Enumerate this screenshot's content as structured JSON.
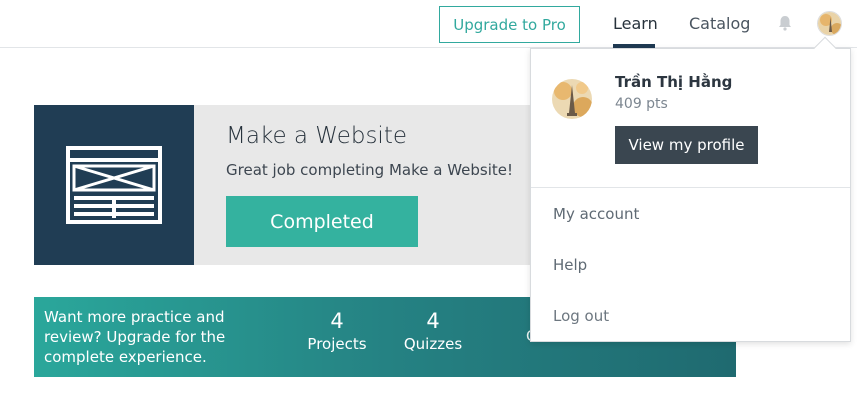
{
  "nav": {
    "upgrade_label": "Upgrade to Pro",
    "learn_label": "Learn",
    "catalog_label": "Catalog",
    "bell_icon": "bell-icon",
    "avatar_icon": "avatar"
  },
  "course": {
    "title": "Make a Website",
    "subtitle": "Great job completing Make a Website!",
    "status_button": "Completed",
    "icon": "website-wireframe-icon"
  },
  "banner": {
    "text": "Want more practice and review? Upgrade for the complete experience.",
    "stats": [
      {
        "value": "4",
        "label": "Projects"
      },
      {
        "value": "4",
        "label": "Quizzes"
      }
    ],
    "cta": "Get Instant Access »"
  },
  "dropdown": {
    "user_name": "Trần Thị Hằng",
    "points": "409 pts",
    "profile_button": "View my profile",
    "items": [
      {
        "label": "My account"
      },
      {
        "label": "Help"
      },
      {
        "label": "Log out"
      }
    ]
  },
  "colors": {
    "accent": "#34b29f",
    "navy": "#203d54",
    "dark_button": "#3a4650"
  }
}
